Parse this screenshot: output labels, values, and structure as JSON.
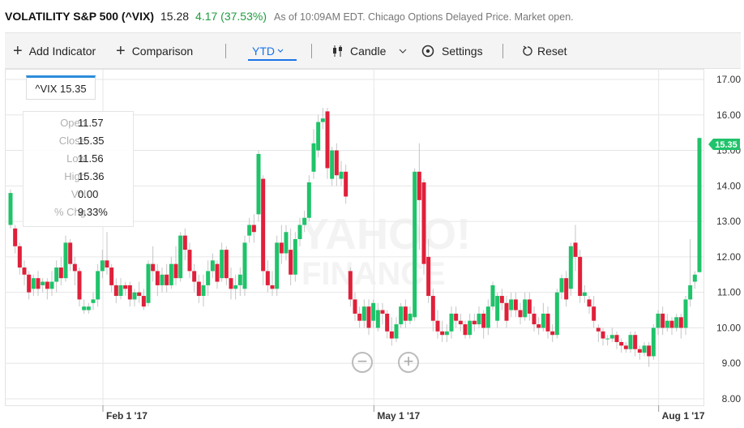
{
  "quote": {
    "symbol": "VOLATILITY S&P 500 (^VIX)",
    "price": "15.28",
    "change": "4.17 (37.53%)",
    "as_of": "As of 10:09AM EDT. Chicago Options Delayed Price. Market open."
  },
  "toolbar": {
    "add_indicator": "Add Indicator",
    "comparison": "Comparison",
    "range": "YTD",
    "chart_type": "Candle",
    "settings": "Settings",
    "reset": "Reset"
  },
  "legend": {
    "label": "^VIX 15.35"
  },
  "ohlc_box": [
    {
      "label": "Open",
      "value": "11.57"
    },
    {
      "label": "Close",
      "value": "15.35"
    },
    {
      "label": "Low",
      "value": "11.56"
    },
    {
      "label": "High",
      "value": "15.36"
    },
    {
      "label": "Vol",
      "value": "0.00"
    },
    {
      "label": "% Chg",
      "value": "9.33%"
    }
  ],
  "watermark": {
    "line1": "YAHOO!",
    "line2": "FINANCE"
  },
  "colors": {
    "up": "#1fc36a",
    "down": "#e0203a",
    "accent": "#1a73e8",
    "grid": "#e6e6e6"
  },
  "chart_data": {
    "type": "candlestick",
    "title": "",
    "ylim": [
      8.0,
      17.0
    ],
    "y_ticks": [
      "17.00",
      "16.00",
      "15.00",
      "14.00",
      "13.00",
      "12.00",
      "11.00",
      "10.00",
      "9.00",
      "8.00"
    ],
    "x_ticks": [
      {
        "label": "Feb 1 '17",
        "index": 21
      },
      {
        "label": "May 1 '17",
        "index": 80
      },
      {
        "label": "Aug 1 '17",
        "index": 142
      }
    ],
    "last_price_label": "15.35",
    "candles": [
      [
        12.9,
        13.8,
        12.8,
        13.9
      ],
      [
        12.8,
        12.3,
        12.1,
        12.9
      ],
      [
        12.3,
        11.7,
        11.5,
        12.4
      ],
      [
        11.7,
        11.5,
        11.2,
        11.9
      ],
      [
        11.5,
        11.0,
        10.8,
        11.6
      ],
      [
        11.1,
        11.4,
        10.9,
        11.5
      ],
      [
        11.4,
        11.1,
        10.9,
        11.6
      ],
      [
        11.2,
        11.3,
        11.0,
        11.4
      ],
      [
        11.3,
        11.1,
        10.8,
        11.4
      ],
      [
        11.1,
        11.3,
        10.9,
        11.6
      ],
      [
        11.3,
        11.7,
        11.0,
        11.9
      ],
      [
        11.7,
        11.4,
        11.2,
        12.0
      ],
      [
        11.4,
        12.4,
        11.3,
        12.6
      ],
      [
        12.4,
        11.8,
        11.6,
        12.5
      ],
      [
        11.8,
        11.6,
        11.2,
        12.0
      ],
      [
        11.6,
        10.8,
        10.6,
        11.7
      ],
      [
        10.5,
        10.6,
        10.4,
        10.8
      ],
      [
        10.5,
        10.6,
        10.4,
        10.7
      ],
      [
        10.7,
        10.8,
        10.5,
        11.0
      ],
      [
        10.8,
        11.6,
        10.6,
        11.8
      ],
      [
        11.6,
        11.9,
        11.4,
        12.2
      ],
      [
        11.9,
        11.7,
        11.5,
        12.7
      ],
      [
        11.7,
        11.2,
        11.0,
        11.8
      ],
      [
        11.2,
        10.9,
        10.7,
        11.4
      ],
      [
        10.9,
        11.2,
        10.8,
        11.4
      ],
      [
        11.2,
        11.1,
        10.9,
        11.3
      ],
      [
        11.2,
        10.8,
        10.6,
        11.3
      ],
      [
        10.8,
        11.0,
        10.6,
        11.1
      ],
      [
        11.0,
        10.9,
        10.7,
        11.3
      ],
      [
        10.9,
        10.6,
        10.5,
        11.1
      ],
      [
        10.7,
        11.8,
        10.6,
        11.9
      ],
      [
        11.8,
        11.6,
        11.3,
        12.3
      ],
      [
        11.6,
        11.2,
        10.9,
        11.8
      ],
      [
        11.2,
        11.5,
        11.0,
        11.7
      ],
      [
        11.5,
        11.2,
        11.0,
        11.8
      ],
      [
        11.2,
        11.8,
        11.1,
        12.0
      ],
      [
        11.8,
        11.4,
        11.2,
        12.3
      ],
      [
        11.4,
        12.6,
        11.3,
        12.7
      ],
      [
        12.6,
        12.2,
        11.9,
        12.8
      ],
      [
        12.2,
        11.6,
        11.4,
        12.4
      ],
      [
        11.6,
        11.3,
        11.0,
        11.8
      ],
      [
        11.3,
        10.9,
        10.7,
        11.5
      ],
      [
        10.9,
        11.2,
        10.6,
        11.5
      ],
      [
        11.2,
        11.6,
        10.9,
        11.9
      ],
      [
        11.6,
        11.9,
        11.4,
        12.1
      ],
      [
        11.8,
        11.3,
        11.1,
        11.9
      ],
      [
        11.4,
        12.2,
        11.3,
        12.4
      ],
      [
        12.2,
        11.4,
        11.2,
        12.3
      ],
      [
        11.4,
        11.1,
        10.8,
        11.7
      ],
      [
        11.1,
        11.2,
        10.8,
        11.5
      ],
      [
        11.2,
        11.5,
        10.9,
        11.7
      ],
      [
        11.1,
        12.4,
        10.9,
        12.6
      ],
      [
        12.6,
        12.9,
        12.4,
        13.1
      ],
      [
        12.9,
        12.7,
        12.4,
        13.2
      ],
      [
        13.2,
        14.9,
        13.0,
        15.0
      ],
      [
        14.2,
        11.6,
        11.2,
        14.3
      ],
      [
        11.6,
        11.2,
        11.0,
        11.9
      ],
      [
        11.2,
        11.1,
        10.9,
        11.6
      ],
      [
        11.1,
        12.4,
        10.9,
        12.6
      ],
      [
        12.4,
        12.1,
        11.8,
        12.9
      ],
      [
        12.1,
        12.7,
        11.9,
        12.9
      ],
      [
        12.2,
        11.5,
        11.2,
        12.8
      ],
      [
        11.5,
        12.5,
        11.3,
        12.7
      ],
      [
        12.5,
        12.9,
        12.3,
        13.1
      ],
      [
        12.9,
        13.1,
        12.7,
        13.3
      ],
      [
        13.1,
        14.1,
        13.0,
        14.3
      ],
      [
        14.4,
        15.2,
        14.2,
        15.6
      ],
      [
        15.0,
        15.8,
        14.8,
        16.0
      ],
      [
        15.8,
        15.9,
        15.6,
        16.2
      ],
      [
        16.1,
        14.5,
        14.2,
        16.2
      ],
      [
        14.2,
        15.0,
        14.0,
        15.1
      ],
      [
        15.0,
        14.3,
        14.0,
        15.2
      ],
      [
        14.2,
        14.4,
        14.0,
        14.7
      ],
      [
        14.4,
        13.7,
        13.5,
        14.6
      ],
      [
        11.6,
        10.8,
        10.6,
        11.7
      ],
      [
        10.8,
        10.4,
        10.2,
        11.0
      ],
      [
        10.4,
        10.2,
        10.0,
        10.6
      ],
      [
        10.2,
        10.6,
        10.0,
        10.8
      ],
      [
        10.6,
        10.0,
        9.8,
        10.8
      ],
      [
        10.2,
        10.7,
        10.0,
        10.8
      ],
      [
        10.0,
        10.5,
        9.9,
        10.7
      ],
      [
        10.5,
        10.4,
        10.1,
        10.7
      ],
      [
        10.4,
        9.9,
        9.7,
        10.5
      ],
      [
        9.9,
        9.7,
        9.5,
        10.3
      ],
      [
        9.7,
        10.1,
        9.6,
        10.3
      ],
      [
        10.1,
        10.6,
        10.0,
        10.7
      ],
      [
        10.6,
        10.2,
        10.0,
        10.8
      ],
      [
        10.2,
        10.4,
        10.1,
        10.6
      ],
      [
        10.3,
        14.4,
        10.2,
        14.5
      ],
      [
        14.4,
        13.6,
        12.2,
        15.2
      ],
      [
        14.1,
        11.8,
        11.5,
        14.2
      ],
      [
        12.0,
        10.9,
        10.7,
        12.5
      ],
      [
        10.9,
        10.2,
        9.9,
        11.1
      ],
      [
        10.2,
        9.9,
        9.7,
        10.5
      ],
      [
        9.9,
        9.8,
        9.6,
        10.2
      ],
      [
        9.8,
        9.9,
        9.6,
        10.1
      ],
      [
        9.9,
        10.4,
        9.7,
        10.6
      ],
      [
        10.4,
        10.2,
        10.0,
        10.6
      ],
      [
        10.2,
        10.1,
        9.9,
        10.4
      ],
      [
        10.1,
        9.8,
        9.7,
        10.2
      ],
      [
        9.8,
        10.2,
        9.7,
        10.4
      ],
      [
        10.2,
        10.1,
        9.9,
        10.4
      ],
      [
        10.1,
        10.4,
        10.0,
        10.6
      ],
      [
        10.4,
        10.0,
        9.7,
        10.5
      ],
      [
        10.0,
        10.6,
        9.8,
        10.8
      ],
      [
        10.6,
        11.2,
        10.5,
        11.3
      ],
      [
        10.2,
        10.9,
        10.0,
        11.0
      ],
      [
        10.9,
        10.7,
        10.5,
        11.1
      ],
      [
        10.7,
        10.2,
        10.0,
        10.9
      ],
      [
        10.5,
        10.8,
        10.3,
        11.0
      ],
      [
        10.8,
        10.5,
        10.3,
        11.0
      ],
      [
        10.5,
        10.3,
        10.1,
        10.7
      ],
      [
        10.3,
        10.8,
        10.2,
        11.0
      ],
      [
        10.8,
        10.4,
        10.2,
        11.0
      ],
      [
        10.4,
        10.1,
        9.9,
        10.6
      ],
      [
        10.1,
        10.0,
        9.8,
        10.3
      ],
      [
        10.0,
        10.4,
        9.9,
        10.7
      ],
      [
        10.4,
        9.9,
        9.7,
        10.6
      ],
      [
        9.9,
        9.8,
        9.6,
        10.1
      ],
      [
        9.8,
        11.0,
        9.7,
        11.1
      ],
      [
        11.0,
        11.4,
        10.8,
        11.5
      ],
      [
        11.4,
        10.8,
        10.6,
        11.6
      ],
      [
        11.1,
        12.3,
        10.9,
        12.4
      ],
      [
        12.4,
        12.0,
        11.6,
        12.9
      ],
      [
        12.0,
        10.9,
        10.7,
        12.2
      ],
      [
        10.9,
        11.0,
        10.7,
        11.2
      ],
      [
        10.8,
        10.6,
        10.4,
        10.9
      ],
      [
        10.6,
        10.2,
        10.0,
        10.9
      ],
      [
        10.0,
        9.9,
        9.6,
        10.1
      ],
      [
        9.9,
        9.7,
        9.5,
        10.0
      ],
      [
        9.7,
        9.7,
        9.5,
        9.8
      ],
      [
        9.7,
        9.8,
        9.6,
        10.0
      ],
      [
        9.8,
        9.6,
        9.4,
        9.9
      ],
      [
        9.6,
        9.5,
        9.3,
        9.7
      ],
      [
        9.5,
        9.4,
        9.3,
        9.6
      ],
      [
        9.4,
        9.8,
        9.3,
        9.9
      ],
      [
        9.8,
        9.4,
        9.2,
        9.9
      ],
      [
        9.4,
        9.3,
        9.1,
        9.5
      ],
      [
        9.3,
        9.5,
        9.2,
        9.6
      ],
      [
        9.5,
        9.2,
        8.9,
        9.6
      ],
      [
        9.2,
        10.0,
        9.1,
        10.1
      ],
      [
        10.0,
        10.4,
        9.8,
        10.5
      ],
      [
        10.4,
        10.0,
        9.8,
        10.6
      ],
      [
        10.0,
        10.2,
        9.9,
        10.4
      ],
      [
        10.2,
        10.0,
        9.8,
        10.3
      ],
      [
        10.0,
        10.3,
        9.9,
        10.4
      ],
      [
        10.3,
        10.0,
        9.7,
        10.4
      ],
      [
        10.0,
        10.8,
        9.8,
        10.9
      ],
      [
        10.8,
        11.2,
        10.6,
        12.5
      ],
      [
        11.3,
        11.5,
        11.1,
        11.6
      ],
      [
        11.57,
        15.35,
        11.56,
        15.36
      ]
    ]
  }
}
